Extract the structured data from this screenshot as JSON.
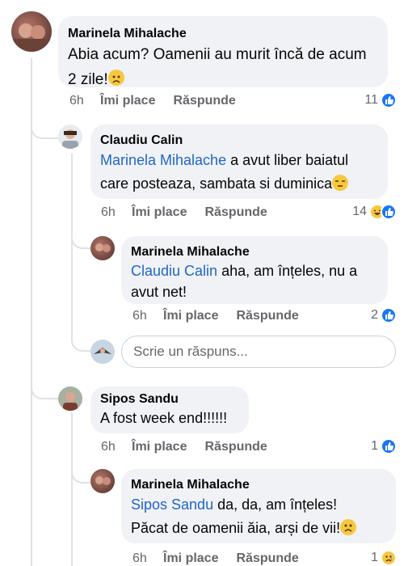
{
  "comments": [
    {
      "author": "Marinela Mihalache",
      "text_line1": "Abia acum? Oamenii au murit încă de acum",
      "text_line2": "2 zile!",
      "time": "6h",
      "like": "Îmi place",
      "reply": "Răspunde",
      "reactions": "11",
      "emoji": "sad-face"
    },
    {
      "author": "Claudiu Calin",
      "mention": "Marinela Mihalache",
      "text_line1": " a avut liber baiatul",
      "text_line2": "care posteaza, sambata si duminica",
      "time": "6h",
      "like": "Îmi place",
      "reply": "Răspunde",
      "reactions": "14",
      "emoji": "unamused-face"
    },
    {
      "author": "Marinela Mihalache",
      "mention": "Claudiu Calin",
      "text_line1": " aha, am înțeles,  nu a",
      "text_line2": "avut net!",
      "time": "6h",
      "like": "Îmi place",
      "reply": "Răspunde",
      "reactions": "2"
    },
    {
      "author": "Sipos Sandu",
      "text_line1": "A fost week end!!!!!!",
      "time": "6h",
      "like": "Îmi place",
      "reply": "Răspunde",
      "reactions": "1"
    },
    {
      "author": "Marinela Mihalache",
      "mention": "Sipos Sandu",
      "text_line1": " da, da, am înțeles!",
      "text_line2": "Păcat de oamenii ăia,  arși de vii!",
      "time": "6h",
      "like": "Îmi place",
      "reply": "Răspunde",
      "reactions": "1",
      "emoji": "sad-face"
    }
  ],
  "reply_box": {
    "placeholder": "Scrie un răspuns..."
  },
  "colors": {
    "mention": "#2166c7",
    "bubble": "#f0f2f5",
    "like_blue": "#1877f2",
    "muted": "#65676b"
  }
}
